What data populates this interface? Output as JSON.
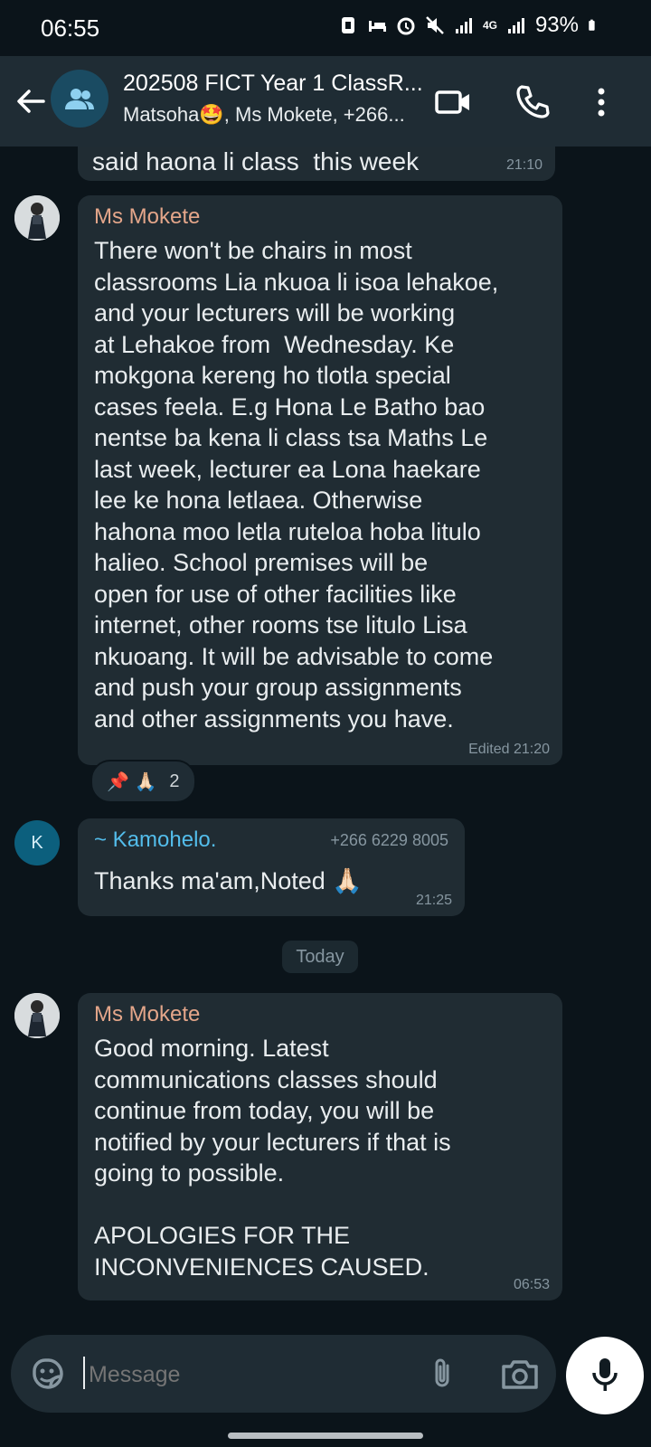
{
  "status_bar": {
    "time": "06:55",
    "battery": "93%",
    "network": "4G"
  },
  "header": {
    "title": "202508 FICT Year 1 ClassR...",
    "subtitle": "Matsoha🤩, Ms Mokete, +266..."
  },
  "messages": [
    {
      "text": "said haona li class  this week",
      "time": "21:10"
    },
    {
      "sender": "Ms Mokete",
      "text": "There won't be chairs in most\nclassrooms Lia nkuoa li isoa lehakoe,\nand your lecturers will be working\nat Lehakoe from  Wednesday. Ke\nmokgona kereng ho tlotla special\ncases feela. E.g Hona Le Batho bao\nnentse ba kena li class tsa Maths Le\nlast week, lecturer ea Lona haekare\nlee ke hona letlaea. Otherwise\nhahona moo letla ruteloa hoba litulo\nhalieo. School premises will be\nopen for use of other facilities like\ninternet, other rooms tse litulo Lisa\nnkuoang. It will be advisable to come\nand push your group assignments\nand other assignments you have.",
      "status": "Edited",
      "time": "21:20",
      "reactions": "📌 🙏🏻",
      "reaction_count": "2"
    },
    {
      "sender": "~ Kamohelo.",
      "phone": "+266 6229 8005",
      "avatar_letter": "K",
      "text": "Thanks ma'am,Noted 🙏🏻",
      "time": "21:25"
    },
    {
      "divider": "Today"
    },
    {
      "sender": "Ms Mokete",
      "text": "Good morning. Latest\ncommunications classes should\ncontinue from today, you will be\nnotified by your lecturers if that is\ngoing to possible.\n\nAPOLOGIES FOR THE\nINCONVENIENCES CAUSED.",
      "time": "06:53"
    }
  ],
  "input": {
    "placeholder": "Message"
  },
  "icons": {
    "back": "arrow-left-icon",
    "group_avatar": "group-icon",
    "video": "video-call-icon",
    "call": "phone-icon",
    "menu": "more-vert-icon",
    "emoji": "sticker-icon",
    "attach": "paperclip-icon",
    "camera": "camera-icon",
    "mic": "microphone-icon"
  },
  "colors": {
    "background": "#0b141a",
    "bubble": "#202c33",
    "header": "#1f2c34",
    "sender_mokete": "#e4a68a",
    "sender_kamohelo": "#53bdeb",
    "meta": "#8696a0"
  }
}
